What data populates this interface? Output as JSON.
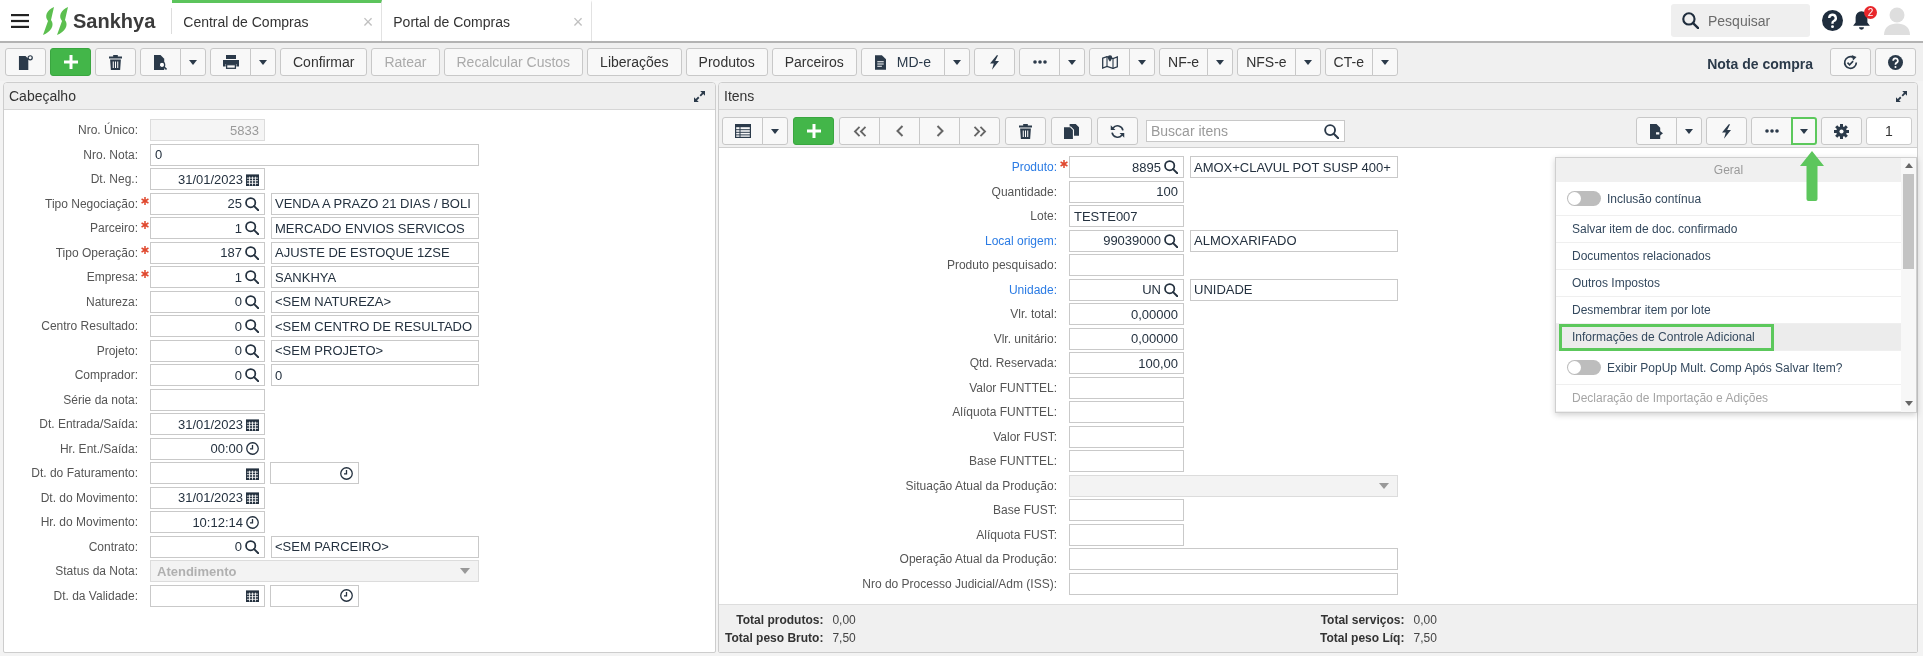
{
  "top_bar": {
    "brand": "Sankhya",
    "tabs": [
      {
        "label": "Central de Compras",
        "close": "×",
        "selected": true
      },
      {
        "label": "Portal de Compras",
        "close": "×",
        "selected": false
      }
    ],
    "search": {
      "placeholder": "Pesquisar"
    },
    "notification_count": "2"
  },
  "toolbar": {
    "groups": [
      [
        {
          "kind": "newdoc",
          "disabled": false
        }
      ],
      [
        {
          "kind": "add",
          "disabled": false
        }
      ],
      [
        {
          "kind": "trash",
          "disabled": false
        }
      ],
      [
        {
          "kind": "finddoc",
          "disabled": false
        },
        {
          "kind": "caret",
          "disabled": false
        }
      ],
      [
        {
          "kind": "print",
          "disabled": false
        },
        {
          "kind": "caret",
          "disabled": false
        }
      ],
      [
        {
          "kind": "text",
          "label": "Confirmar",
          "disabled": false
        }
      ],
      [
        {
          "kind": "text",
          "label": "Ratear",
          "disabled": true
        }
      ],
      [
        {
          "kind": "text",
          "label": "Recalcular Custos",
          "disabled": true
        }
      ],
      [
        {
          "kind": "text",
          "label": "Liberações",
          "disabled": false
        }
      ],
      [
        {
          "kind": "text",
          "label": "Produtos",
          "disabled": false
        }
      ],
      [
        {
          "kind": "text",
          "label": "Parceiros",
          "disabled": false
        }
      ],
      [
        {
          "kind": "document",
          "label": "MD-e",
          "disabled": false
        },
        {
          "kind": "caret",
          "disabled": false
        }
      ],
      [
        {
          "kind": "bolt",
          "disabled": false
        }
      ],
      [
        {
          "kind": "more",
          "disabled": false
        },
        {
          "kind": "caret",
          "disabled": false
        }
      ],
      [
        {
          "kind": "map",
          "disabled": false
        },
        {
          "kind": "caret",
          "disabled": false
        }
      ],
      [
        {
          "kind": "text",
          "label": "NF-e",
          "disabled": false
        },
        {
          "kind": "caret",
          "disabled": false
        }
      ],
      [
        {
          "kind": "text",
          "label": "NFS-e",
          "disabled": false
        },
        {
          "kind": "caret",
          "disabled": false
        }
      ],
      [
        {
          "kind": "text",
          "label": "CT-e",
          "disabled": false
        },
        {
          "kind": "caret",
          "disabled": false
        }
      ]
    ],
    "title": "Nota de compra",
    "right_buttons": [
      {
        "kind": "sync",
        "disabled": false
      },
      {
        "kind": "help",
        "disabled": false
      }
    ]
  },
  "header_panel": {
    "title": "Cabeçalho",
    "fields": [
      {
        "label": "Nro. Único:",
        "kind": "number",
        "value": "5833",
        "required": false,
        "disabled": true
      },
      {
        "label": "Nro. Nota:",
        "kind": "text",
        "value": "0",
        "required": false,
        "disabled": false
      },
      {
        "label": "Dt. Neg.:",
        "kind": "date",
        "value": "31/01/2023",
        "required": false,
        "disabled": false
      },
      {
        "label": "Tipo Negociação:",
        "kind": "lookup",
        "value": "25",
        "description": "VENDA A PRAZO 21 DIAS / BOLI",
        "required": true,
        "disabled": false
      },
      {
        "label": "Parceiro:",
        "kind": "lookup",
        "value": "1",
        "description": "MERCADO ENVIOS SERVICOS",
        "required": true,
        "disabled": false
      },
      {
        "label": "Tipo Operação:",
        "kind": "lookup",
        "value": "187",
        "description": "AJUSTE DE ESTOQUE 1ZSE",
        "required": true,
        "disabled": false
      },
      {
        "label": "Empresa:",
        "kind": "lookup",
        "value": "1",
        "description": "SANKHYA",
        "required": true,
        "disabled": false
      },
      {
        "label": "Natureza:",
        "kind": "lookup",
        "value": "0",
        "description": "<SEM NATUREZA>",
        "required": false,
        "disabled": false
      },
      {
        "label": "Centro Resultado:",
        "kind": "lookup",
        "value": "0",
        "description": "<SEM CENTRO DE RESULTADO",
        "required": false,
        "disabled": false
      },
      {
        "label": "Projeto:",
        "kind": "lookup",
        "value": "0",
        "description": "<SEM PROJETO>",
        "required": false,
        "disabled": false
      },
      {
        "label": "Comprador:",
        "kind": "lookup",
        "value": "0",
        "description": "0",
        "required": false,
        "disabled": false
      },
      {
        "label": "Série da nota:",
        "kind": "code",
        "required": false,
        "disabled": false
      },
      {
        "label": "Dt. Entrada/Saída:",
        "kind": "date",
        "value": "31/01/2023",
        "required": false,
        "disabled": false
      },
      {
        "label": "Hr. Ent./Saída:",
        "kind": "time",
        "value": "00:00",
        "required": false,
        "disabled": false
      },
      {
        "label": "Dt. do Faturamento:",
        "kind": "datetime",
        "required": false,
        "disabled": false
      },
      {
        "label": "Dt. do Movimento:",
        "kind": "date",
        "value": "31/01/2023",
        "required": false,
        "disabled": false
      },
      {
        "label": "Hr. do Movimento:",
        "kind": "time",
        "value": "10:12:14",
        "required": false,
        "disabled": false
      },
      {
        "label": "Contrato:",
        "kind": "lookup",
        "value": "0",
        "description": "<SEM PARCEIRO>",
        "required": false,
        "disabled": false
      },
      {
        "label": "Status da Nota:",
        "kind": "select",
        "value": "Atendimento",
        "required": false,
        "disabled": true
      },
      {
        "label": "Dt. da Validade:",
        "kind": "datetime",
        "required": false,
        "disabled": false
      }
    ]
  },
  "items_panel": {
    "title": "Itens",
    "toolbar": {
      "groups": [
        [
          {
            "kind": "grid"
          },
          {
            "kind": "caret"
          }
        ],
        [
          {
            "kind": "add"
          }
        ],
        [
          {
            "kind": "first"
          },
          {
            "kind": "previous"
          },
          {
            "kind": "next"
          },
          {
            "kind": "last"
          }
        ],
        [
          {
            "kind": "trash"
          }
        ],
        [
          {
            "kind": "copy"
          }
        ],
        [
          {
            "kind": "refresh"
          }
        ]
      ],
      "search": {
        "placeholder": "Buscar itens"
      },
      "right_groups": [
        [
          {
            "kind": "export",
            "highlighted": false
          },
          {
            "kind": "caret",
            "highlighted": false
          }
        ],
        [
          {
            "kind": "bolt",
            "highlighted": false
          }
        ],
        [
          {
            "kind": "more",
            "highlighted": false
          },
          {
            "kind": "caret",
            "highlighted": true
          }
        ],
        [
          {
            "kind": "gear",
            "highlighted": false
          }
        ]
      ],
      "page": "1"
    },
    "fields": [
      {
        "label": "Produto:",
        "kind": "lookup",
        "value": "8895",
        "description": "AMOX+CLAVUL POT SUSP 400+",
        "required": true,
        "link": true,
        "disabled": false
      },
      {
        "label": "Quantidade:",
        "kind": "number",
        "value": "100",
        "required": false,
        "link": false,
        "disabled": false
      },
      {
        "label": "Lote:",
        "kind": "code",
        "value": "TESTE007",
        "required": false,
        "link": false,
        "disabled": false
      },
      {
        "label": "Local origem:",
        "kind": "lookup",
        "value": "99039000",
        "description": "ALMOXARIFADO",
        "required": false,
        "link": true,
        "disabled": false
      },
      {
        "label": "Produto pesquisado:",
        "kind": "code",
        "required": false,
        "link": false,
        "disabled": false
      },
      {
        "label": "Unidade:",
        "kind": "lookup",
        "value": "UN",
        "description": "UNIDADE",
        "required": false,
        "link": true,
        "disabled": false
      },
      {
        "label": "Vlr. total:",
        "kind": "number",
        "value": "0,00000",
        "required": false,
        "link": false,
        "disabled": false
      },
      {
        "label": "Vlr. unitário:",
        "kind": "number",
        "value": "0,00000",
        "required": false,
        "link": false,
        "disabled": false
      },
      {
        "label": "Qtd. Reservada:",
        "kind": "number",
        "value": "100,00",
        "required": false,
        "link": false,
        "disabled": false
      },
      {
        "label": "Valor FUNTTEL:",
        "kind": "number",
        "required": false,
        "link": false,
        "disabled": false
      },
      {
        "label": "Alíquota FUNTTEL:",
        "kind": "number",
        "required": false,
        "link": false,
        "disabled": false
      },
      {
        "label": "Valor FUST:",
        "kind": "number",
        "required": false,
        "link": false,
        "disabled": false
      },
      {
        "label": "Base FUNTTEL:",
        "kind": "number",
        "required": false,
        "link": false,
        "disabled": false
      },
      {
        "label": "Situação Atual da Produção:",
        "kind": "select",
        "required": false,
        "link": false,
        "disabled": true
      },
      {
        "label": "Base FUST:",
        "kind": "number",
        "required": false,
        "link": false,
        "disabled": false
      },
      {
        "label": "Alíquota FUST:",
        "kind": "number",
        "required": false,
        "link": false,
        "disabled": false
      },
      {
        "label": "Operação Atual da Produção:",
        "kind": "text",
        "required": false,
        "link": false,
        "disabled": false
      },
      {
        "label": "Nro do Processo Judicial/Adm (ISS):",
        "kind": "text",
        "required": false,
        "link": false,
        "disabled": false
      }
    ],
    "menu": {
      "items": [
        {
          "kind": "header",
          "label": "Geral"
        },
        {
          "kind": "toggle",
          "label": "Inclusão contínua",
          "on": false,
          "highlighted": false,
          "disabled": false
        },
        {
          "kind": "action",
          "label": "Salvar item de doc. confirmado",
          "highlighted": false,
          "disabled": false
        },
        {
          "kind": "action",
          "label": "Documentos relacionados",
          "highlighted": false,
          "disabled": false
        },
        {
          "kind": "action",
          "label": "Outros Impostos",
          "highlighted": false,
          "disabled": false
        },
        {
          "kind": "action",
          "label": "Desmembrar item por lote",
          "highlighted": false,
          "disabled": false
        },
        {
          "kind": "action",
          "label": "Informações de Controle Adicional",
          "highlighted": true,
          "disabled": false
        },
        {
          "kind": "toggle",
          "label": "Exibir PopUp Mult. Comp Após Salvar Item?",
          "on": false,
          "highlighted": false,
          "disabled": false
        },
        {
          "kind": "action",
          "label": "Declaração de Importação e Adições",
          "highlighted": false,
          "disabled": true
        }
      ]
    },
    "totals": [
      [
        {
          "label": "Total produtos:",
          "value": "0,00"
        },
        {
          "label": "Total peso Bruto:",
          "value": "7,50"
        }
      ],
      [
        {
          "label": "Total serviços:",
          "value": "0,00"
        },
        {
          "label": "Total peso Líq:",
          "value": "7,50"
        }
      ]
    ]
  }
}
